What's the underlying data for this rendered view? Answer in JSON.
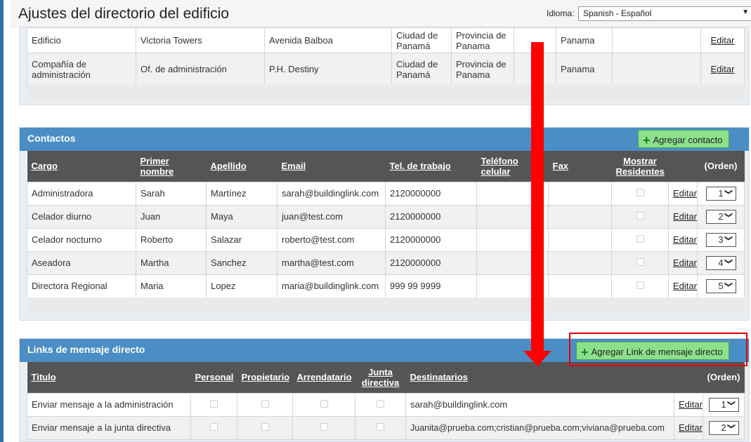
{
  "header": {
    "title": "Ajustes del directorio del edificio",
    "language_label": "Idioma:",
    "language_value": "Spanish - Español"
  },
  "building_rows": [
    {
      "type": "Edificio",
      "name": "Victoria Towers",
      "address": "Avenida Balboa",
      "city": "Ciudad de Panamá",
      "province": "Provincia de Panama",
      "blank": "",
      "country": "Panama",
      "blank2": "",
      "edit": "Editar"
    },
    {
      "type": "Compañía de administración",
      "name": "Of. de administración",
      "address": "P.H. Destiny",
      "city": "Ciudad de Panamá",
      "province": "Provincia de Panama",
      "blank": "",
      "country": "Panama",
      "blank2": "",
      "edit": "Editar"
    }
  ],
  "contacts": {
    "title": "Contactos",
    "add_button": "Agregar contacto",
    "headers": [
      "Cargo",
      "Primer nombre",
      "Apellido",
      "Email",
      "Tel. de trabajo",
      "Teléfono celular",
      "Fax",
      "Mostrar Residentes",
      "",
      "(Orden)"
    ],
    "rows": [
      {
        "cargo": "Administradora",
        "nombre": "Sarah",
        "apellido": "Martínez",
        "email": "sarah@buildinglink.com",
        "tel": "2120000000",
        "cel": "",
        "fax": "",
        "edit": "Editar",
        "orden": "1"
      },
      {
        "cargo": "Celador diurno",
        "nombre": "Juan",
        "apellido": "Maya",
        "email": "juan@test.com",
        "tel": "2120000000",
        "cel": "",
        "fax": "",
        "edit": "Editar",
        "orden": "2"
      },
      {
        "cargo": "Celador nocturno",
        "nombre": "Roberto",
        "apellido": "Salazar",
        "email": "roberto@test.com",
        "tel": "2120000000",
        "cel": "",
        "fax": "",
        "edit": "Editar",
        "orden": "3"
      },
      {
        "cargo": "Aseadora",
        "nombre": "Martha",
        "apellido": "Sanchez",
        "email": "martha@test.com",
        "tel": "2120000000",
        "cel": "",
        "fax": "",
        "edit": "Editar",
        "orden": "4"
      },
      {
        "cargo": "Directora Regional",
        "nombre": "Maria",
        "apellido": "Lopez",
        "email": "maria@buildinglink.com",
        "tel": "999 99 9999",
        "cel": "",
        "fax": "",
        "edit": "Editar",
        "orden": "5"
      }
    ]
  },
  "links": {
    "title": "Links de mensaje directo",
    "add_button": "Agregar Link de mensaje directo",
    "headers": [
      "Titulo",
      "Personal",
      "Propietario",
      "Arrendatario",
      "Junta directiva",
      "Destinatarios",
      "",
      "(Orden)"
    ],
    "rows": [
      {
        "titulo": "Enviar mensaje a la administración",
        "dest": "sarah@buildinglink.com",
        "edit": "Editar",
        "orden": "1"
      },
      {
        "titulo": "Enviar mensaje a la junta directiva",
        "dest": "Juanita@prueba.com;cristian@prueba.com;viviana@prueba.com",
        "edit": "Editar",
        "orden": "2"
      }
    ]
  },
  "colors": {
    "header_blue": "#4a8ec5",
    "add_green": "#8ce08c",
    "annotation_red": "#ff0000"
  },
  "icons": {
    "plus": "plus-icon",
    "chevron": "chevron-down-icon"
  }
}
